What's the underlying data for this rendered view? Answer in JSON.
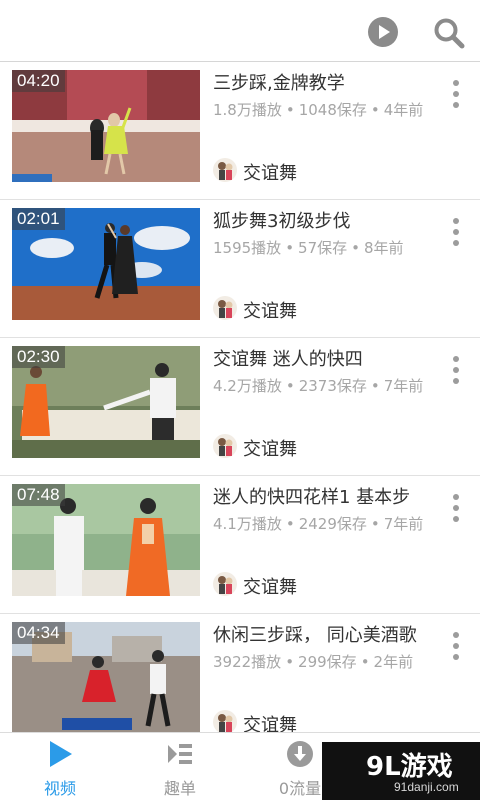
{
  "header": {
    "play_icon": "play-circle-icon",
    "search_icon": "search-icon"
  },
  "videos": [
    {
      "duration": "04:20",
      "title": "三步踩,金牌教学",
      "views": "1.8万播放",
      "saves": "1048保存",
      "age": "4年前",
      "channel": "交谊舞"
    },
    {
      "duration": "02:01",
      "title": "狐步舞3初级步伐",
      "views": "1595播放",
      "saves": "57保存",
      "age": "8年前",
      "channel": "交谊舞"
    },
    {
      "duration": "02:30",
      "title": "交谊舞 迷人的快四",
      "views": "4.2万播放",
      "saves": "2373保存",
      "age": "7年前",
      "channel": "交谊舞"
    },
    {
      "duration": "07:48",
      "title": "迷人的快四花样1 基本步",
      "views": "4.1万播放",
      "saves": "2429保存",
      "age": "7年前",
      "channel": "交谊舞"
    },
    {
      "duration": "04:34",
      "title": "休闲三步踩， 同心美酒歌",
      "views": "3922播放",
      "saves": "299保存",
      "age": "2年前",
      "channel": "交谊舞"
    }
  ],
  "meta_separator": "•",
  "nav": {
    "tabs": [
      {
        "label": "视频",
        "icon": "play-triangle-icon",
        "active": true
      },
      {
        "label": "趣单",
        "icon": "playlist-icon",
        "active": false
      },
      {
        "label": "0流量",
        "icon": "download-icon",
        "active": false
      }
    ]
  },
  "watermark": {
    "main": "9L游戏",
    "sub": "91danji.com"
  },
  "colors": {
    "accent": "#2b9be8",
    "text": "#333333",
    "muted": "#a6a6a6"
  }
}
